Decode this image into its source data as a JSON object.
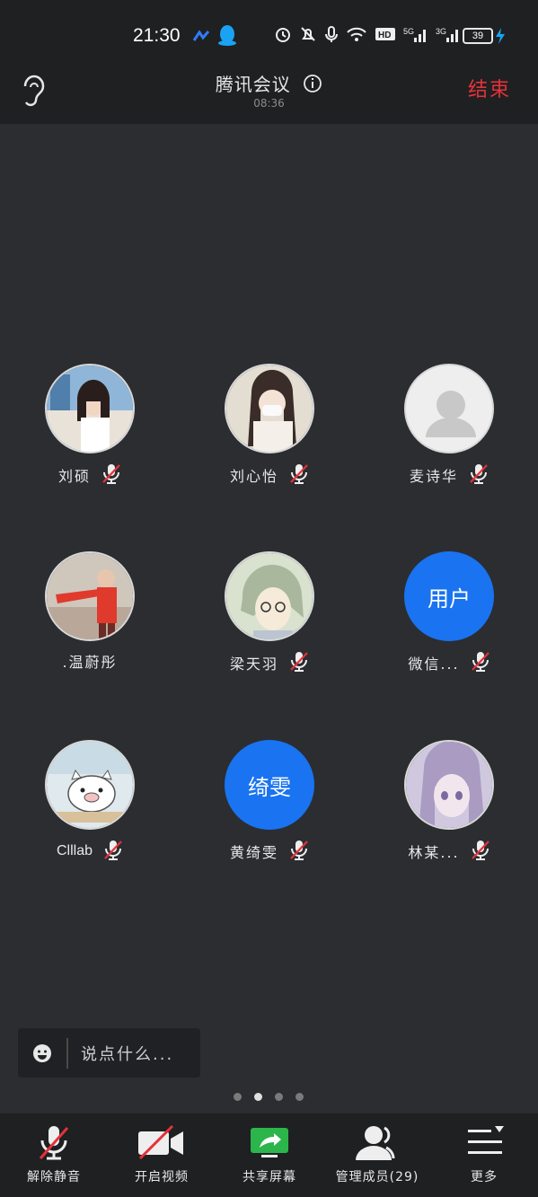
{
  "status": {
    "time": "21:30",
    "battery": "39"
  },
  "header": {
    "title": "腾讯会议",
    "timer": "08:36",
    "end_label": "结束"
  },
  "participants": [
    {
      "name": "刘硕",
      "avatar": "photo"
    },
    {
      "name": "刘心怡",
      "avatar": "photo"
    },
    {
      "name": "麦诗华",
      "avatar": "default"
    },
    {
      "name": ".温蔚彤",
      "avatar": "photo"
    },
    {
      "name": "梁天羽",
      "avatar": "photo"
    },
    {
      "name": "微信...",
      "avatar": "text",
      "avatar_text": "用户"
    },
    {
      "name": "Clllab",
      "avatar": "photo"
    },
    {
      "name": "黄绮雯",
      "avatar": "text",
      "avatar_text": "绮雯"
    },
    {
      "name": "林某...",
      "avatar": "photo"
    }
  ],
  "chat": {
    "placeholder": "说点什么..."
  },
  "pagination": {
    "pages": 4,
    "active": 2
  },
  "toolbar": {
    "unmute": "解除静音",
    "start_video": "开启视频",
    "share_screen": "共享屏幕",
    "manage_members": "管理成员(29)",
    "more": "更多"
  },
  "colors": {
    "accent_blue": "#1a73f0",
    "end_red": "#e5323a",
    "share_green": "#2bb54b"
  }
}
